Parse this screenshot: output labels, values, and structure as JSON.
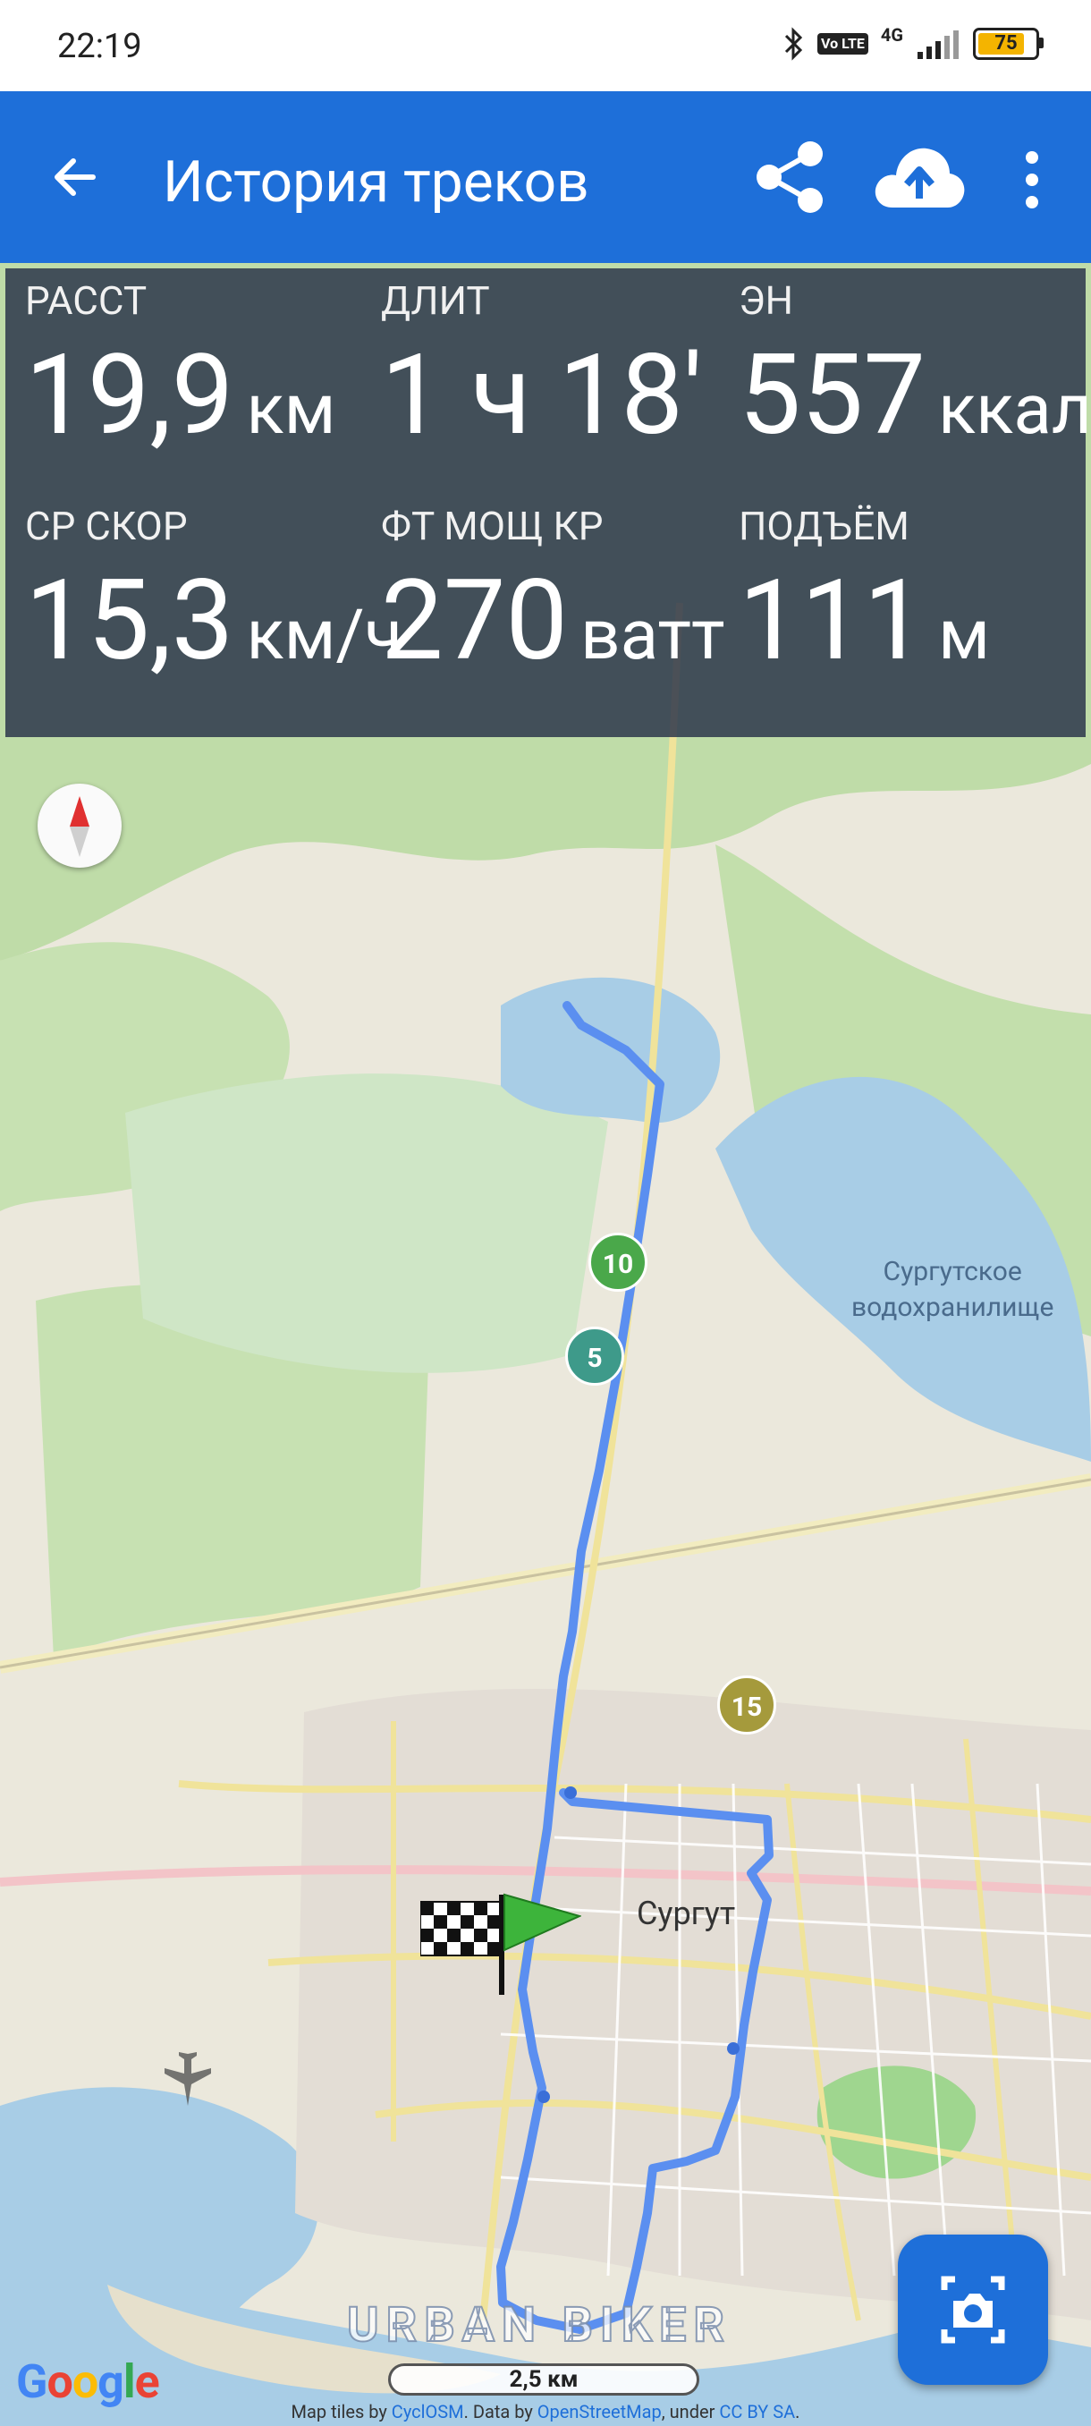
{
  "status_bar": {
    "time": "22:19",
    "volte": "Vo LTE",
    "network": "4G",
    "battery_level": "75",
    "icons": [
      "bluetooth-icon",
      "volte-icon",
      "signal-icon",
      "battery-icon"
    ]
  },
  "app_bar": {
    "title": "История треков",
    "actions": [
      "back-arrow-icon",
      "share-icon",
      "cloud-upload-icon",
      "more-vert-icon"
    ]
  },
  "stats": {
    "distance": {
      "label": "РАССТ",
      "value": "19,9",
      "unit": "км"
    },
    "duration": {
      "label": "ДЛИТ",
      "value": "1 ч 18'",
      "unit": ""
    },
    "energy": {
      "label": "ЭН",
      "value": "557",
      "unit": "ккал"
    },
    "avg_speed": {
      "label": "СР СКОР",
      "value": "15,3",
      "unit": "км/ч"
    },
    "power": {
      "label": "ФТ МОЩ КР",
      "value": "270",
      "unit": "ватт"
    },
    "climb": {
      "label": "ПОДЪЁМ",
      "value": "111",
      "unit": "м"
    }
  },
  "map": {
    "markers": [
      "5",
      "10",
      "15"
    ],
    "lake_label_1": "Сургутское",
    "lake_label_2": "водохранилище",
    "city_label": "Сургут",
    "watermark": "URBAN BIKER",
    "scale": "2,5 км",
    "google": [
      "G",
      "o",
      "o",
      "g",
      "l",
      "e"
    ],
    "attribution": {
      "prefix": "Map tiles by ",
      "tiles": "CyclOSM",
      "mid": ". Data by ",
      "data": "OpenStreetMap",
      "under": ", under ",
      "license": "CC BY SA",
      "end": "."
    },
    "colors": {
      "water": "#a8cde6",
      "forest": "#bcdca5",
      "track": "#5b8ff0",
      "accent": "#1e6fd9"
    }
  }
}
